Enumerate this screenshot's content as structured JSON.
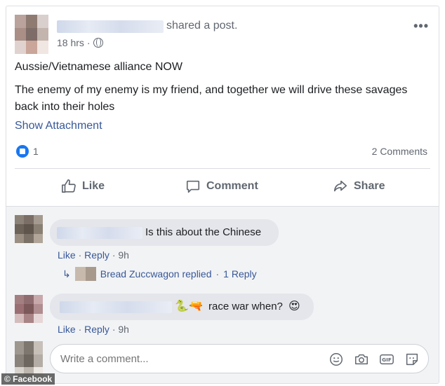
{
  "header": {
    "shared_text": "shared a post.",
    "timestamp": "18 hrs",
    "more": "•••"
  },
  "post": {
    "line1": "Aussie/Vietnamese alliance NOW",
    "line2": "The enemy of my enemy is my friend, and together we will drive these savages back into their holes",
    "attachment_link": "Show Attachment",
    "like_count": "1",
    "comments_count": "2 Comments"
  },
  "actions": {
    "like": "Like",
    "comment": "Comment",
    "share": "Share"
  },
  "comments": [
    {
      "text": "Is this about the Chinese",
      "like": "Like",
      "reply": "Reply",
      "time": "9h",
      "replied_by": "Bread Zuccwagon replied",
      "reply_count": "1 Reply"
    },
    {
      "text": "race war when?",
      "like": "Like",
      "reply": "Reply",
      "time": "9h"
    }
  ],
  "composer": {
    "placeholder": "Write a comment..."
  },
  "credit": "© Facebook",
  "colors": {
    "link": "#385898",
    "facebook_blue": "#1877f2",
    "muted": "#616770"
  }
}
